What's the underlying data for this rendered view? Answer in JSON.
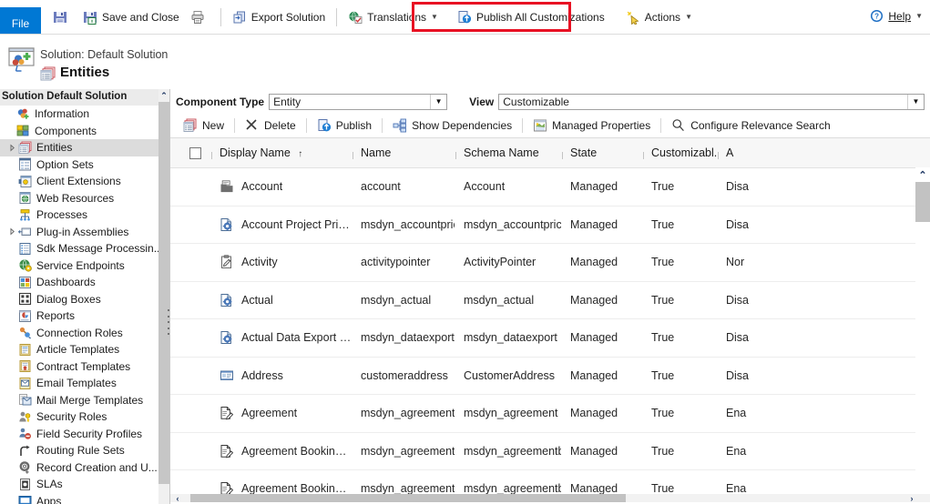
{
  "ribbon": {
    "file_tab": "File",
    "items": [
      {
        "label": "",
        "icon": "save-icon",
        "name": "save-button"
      },
      {
        "label": "Save and Close",
        "icon": "save-and-close-icon",
        "name": "save-and-close-button"
      },
      {
        "label": "",
        "icon": "print-icon",
        "name": "print-button"
      },
      {
        "label": "Export Solution",
        "icon": "export-solution-icon",
        "name": "export-solution-button"
      },
      {
        "label": "Translations",
        "icon": "translations-icon",
        "name": "translations-button",
        "caret": true
      },
      {
        "label": "Publish All Customizations",
        "icon": "publish-all-icon",
        "name": "publish-all-customizations-button"
      },
      {
        "label": "Actions",
        "icon": "actions-icon",
        "name": "actions-button",
        "caret": true
      }
    ],
    "help_label": "Help",
    "highlight_color": "#e81123"
  },
  "header": {
    "solution_line": "Solution: Default Solution",
    "page_title": "Entities"
  },
  "sidebar": {
    "title": "Solution Default Solution",
    "items": [
      {
        "label": "Information",
        "icon": "information-icon",
        "twisty": false,
        "selected": false
      },
      {
        "label": "Components",
        "icon": "components-icon",
        "twisty": false,
        "selected": false
      },
      {
        "label": "Entities",
        "icon": "entities-icon",
        "twisty": true,
        "selected": true,
        "indent": 1
      },
      {
        "label": "Option Sets",
        "icon": "option-sets-icon",
        "twisty": false,
        "indent": 1
      },
      {
        "label": "Client Extensions",
        "icon": "client-extensions-icon",
        "twisty": false,
        "indent": 1
      },
      {
        "label": "Web Resources",
        "icon": "web-resources-icon",
        "twisty": false,
        "indent": 1
      },
      {
        "label": "Processes",
        "icon": "processes-icon",
        "twisty": false,
        "indent": 1
      },
      {
        "label": "Plug-in Assemblies",
        "icon": "plugin-assemblies-icon",
        "twisty": true,
        "indent": 1
      },
      {
        "label": "Sdk Message Processin...",
        "icon": "sdk-message-icon",
        "twisty": false,
        "indent": 1
      },
      {
        "label": "Service Endpoints",
        "icon": "service-endpoints-icon",
        "twisty": false,
        "indent": 1
      },
      {
        "label": "Dashboards",
        "icon": "dashboards-icon",
        "twisty": false,
        "indent": 1
      },
      {
        "label": "Dialog Boxes",
        "icon": "dialog-boxes-icon",
        "twisty": false,
        "indent": 1
      },
      {
        "label": "Reports",
        "icon": "reports-icon",
        "twisty": false,
        "indent": 1
      },
      {
        "label": "Connection Roles",
        "icon": "connection-roles-icon",
        "twisty": false,
        "indent": 1
      },
      {
        "label": "Article Templates",
        "icon": "article-templates-icon",
        "twisty": false,
        "indent": 1
      },
      {
        "label": "Contract Templates",
        "icon": "contract-templates-icon",
        "twisty": false,
        "indent": 1
      },
      {
        "label": "Email Templates",
        "icon": "email-templates-icon",
        "twisty": false,
        "indent": 1
      },
      {
        "label": "Mail Merge Templates",
        "icon": "mail-merge-templates-icon",
        "twisty": false,
        "indent": 1
      },
      {
        "label": "Security Roles",
        "icon": "security-roles-icon",
        "twisty": false,
        "indent": 1
      },
      {
        "label": "Field Security Profiles",
        "icon": "field-security-profiles-icon",
        "twisty": false,
        "indent": 1
      },
      {
        "label": "Routing Rule Sets",
        "icon": "routing-rule-sets-icon",
        "twisty": false,
        "indent": 1
      },
      {
        "label": "Record Creation and U...",
        "icon": "record-creation-icon",
        "twisty": false,
        "indent": 1
      },
      {
        "label": "SLAs",
        "icon": "slas-icon",
        "twisty": false,
        "indent": 1
      },
      {
        "label": "Apps",
        "icon": "apps-icon",
        "twisty": false,
        "indent": 1
      }
    ]
  },
  "filters": {
    "component_type_label": "Component Type",
    "component_type_value": "Entity",
    "view_label": "View",
    "view_value": "Customizable"
  },
  "gridtools": [
    {
      "label": "New",
      "icon": "new-icon",
      "name": "new-button"
    },
    {
      "label": "Delete",
      "icon": "delete-icon",
      "name": "delete-button"
    },
    {
      "label": "Publish",
      "icon": "publish-icon",
      "name": "publish-button"
    },
    {
      "label": "Show Dependencies",
      "icon": "show-dependencies-icon",
      "name": "show-dependencies-button"
    },
    {
      "label": "Managed Properties",
      "icon": "managed-properties-icon",
      "name": "managed-properties-button"
    },
    {
      "label": "Configure Relevance Search",
      "icon": "search-icon",
      "name": "configure-relevance-search-button"
    }
  ],
  "grid": {
    "columns": [
      {
        "label": "Display Name",
        "sort": "↑"
      },
      {
        "label": "Name"
      },
      {
        "label": "Schema Name"
      },
      {
        "label": "State"
      },
      {
        "label": "Customizabl.."
      },
      {
        "label": "A "
      }
    ],
    "rows": [
      {
        "icon": "entity-record-icon",
        "display_name": "Account",
        "name": "account",
        "schema_name": "Account",
        "state": "Managed",
        "customizable": "True",
        "audit": "Disa"
      },
      {
        "icon": "entity-gear-icon",
        "display_name": "Account Project Price List",
        "name": "msdyn_accountprice...",
        "schema_name": "msdyn_accountprice...",
        "state": "Managed",
        "customizable": "True",
        "audit": "Disa"
      },
      {
        "icon": "entity-clipboard-icon",
        "display_name": "Activity",
        "name": "activitypointer",
        "schema_name": "ActivityPointer",
        "state": "Managed",
        "customizable": "True",
        "audit": "Nor"
      },
      {
        "icon": "entity-gear-icon",
        "display_name": "Actual",
        "name": "msdyn_actual",
        "schema_name": "msdyn_actual",
        "state": "Managed",
        "customizable": "True",
        "audit": "Disa"
      },
      {
        "icon": "entity-gear-icon",
        "display_name": "Actual Data Export (Deprecat...",
        "name": "msdyn_dataexport",
        "schema_name": "msdyn_dataexport",
        "state": "Managed",
        "customizable": "True",
        "audit": "Disa"
      },
      {
        "icon": "entity-address-icon",
        "display_name": "Address",
        "name": "customeraddress",
        "schema_name": "CustomerAddress",
        "state": "Managed",
        "customizable": "True",
        "audit": "Disa"
      },
      {
        "icon": "entity-doc-icon",
        "display_name": "Agreement",
        "name": "msdyn_agreement",
        "schema_name": "msdyn_agreement",
        "state": "Managed",
        "customizable": "True",
        "audit": "Ena"
      },
      {
        "icon": "entity-doc-icon",
        "display_name": "Agreement Booking Date",
        "name": "msdyn_agreementb...",
        "schema_name": "msdyn_agreementb...",
        "state": "Managed",
        "customizable": "True",
        "audit": "Ena"
      },
      {
        "icon": "entity-doc-icon",
        "display_name": "Agreement Booking Incident",
        "name": "msdyn_agreementb...",
        "schema_name": "msdyn_agreementb...",
        "state": "Managed",
        "customizable": "True",
        "audit": "Ena"
      }
    ]
  }
}
